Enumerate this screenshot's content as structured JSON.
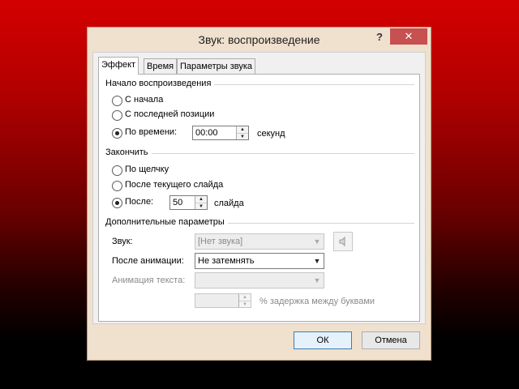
{
  "dialog": {
    "title": "Звук: воспроизведение",
    "help": "?",
    "close": "✕"
  },
  "tabs": [
    {
      "label": "Эффект",
      "active": true
    },
    {
      "label": "Время",
      "active": false
    },
    {
      "label": "Параметры звука",
      "active": false
    }
  ],
  "playback_start": {
    "group_label": "Начало воспроизведения",
    "options": [
      {
        "label": "С начала",
        "checked": false
      },
      {
        "label": "С последней позиции",
        "checked": false
      },
      {
        "label": "По времени:",
        "checked": true
      }
    ],
    "time_value": "00:00",
    "time_unit": "секунд"
  },
  "playback_stop": {
    "group_label": "Закончить",
    "options": [
      {
        "label": "По щелчку",
        "checked": false
      },
      {
        "label": "После текущего слайда",
        "checked": false
      },
      {
        "label": "После:",
        "checked": true
      }
    ],
    "after_value": "50",
    "after_unit": "слайда"
  },
  "enhancements": {
    "group_label": "Дополнительные параметры",
    "sound_label": "Звук:",
    "sound_value": "[Нет звука]",
    "after_anim_label": "После анимации:",
    "after_anim_value": "Не затемнять",
    "anim_text_label": "Анимация текста:",
    "anim_text_value": "",
    "delay_value": "",
    "delay_label": "% задержка между буквами"
  },
  "buttons": {
    "ok": "ОК",
    "cancel": "Отмена"
  },
  "icons": {
    "speaker": "speaker-icon",
    "spin_up": "▲",
    "spin_down": "▼",
    "combo_arrow": "▼"
  },
  "colors": {
    "close_button": "#c75050",
    "dialog_frame": "#f0e0ce",
    "ok_border": "#3c7fb1"
  }
}
